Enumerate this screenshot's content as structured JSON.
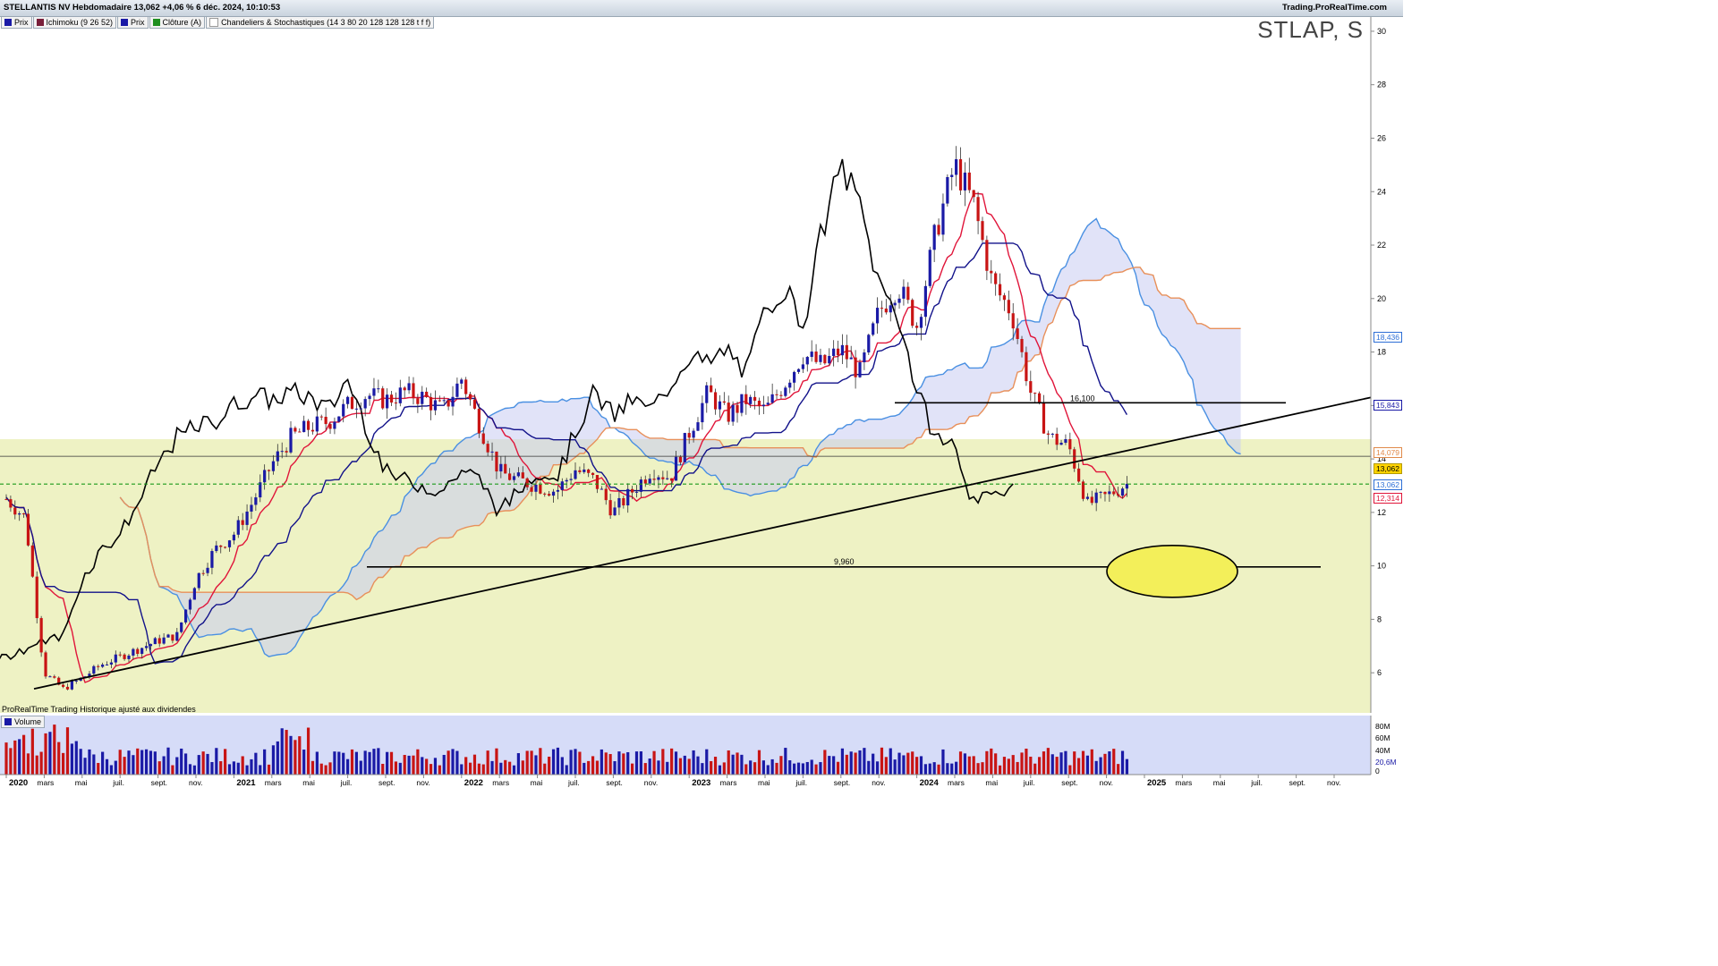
{
  "header": {
    "title": "STELLANTIS NV Hebdomadaire 13,062 +4,06 % 6 déc. 2024, 10:10:53",
    "brand": "Trading.ProRealTime.com"
  },
  "legend": [
    {
      "label": "Prix",
      "color": "#1a1aa6"
    },
    {
      "label": "Ichimoku (9 26 52)",
      "color": "#7a1f3a"
    },
    {
      "label": "Prix",
      "color": "#1a1aa6"
    },
    {
      "label": "Clôture (A)",
      "color": "#1f8f1f"
    },
    {
      "label": "Chandeliers & Stochastiques (14 3 80 20 128 128 128 t f f)",
      "color": "#ffffff"
    }
  ],
  "symbol": "STLAP, S",
  "footer_note": "ProRealTime Trading  Historique ajusté aux dividendes",
  "volume_label": "Volume",
  "annotations": {
    "level_high": "16,100",
    "level_low": "9,960"
  },
  "badges": [
    {
      "text": "18,436",
      "color": "#2e6fd6"
    },
    {
      "text": "15,843",
      "color": "#1a1aa6"
    },
    {
      "text": "14,079",
      "color": "#e08a4a"
    },
    {
      "text": "13,062",
      "color": "#000000",
      "bg": "#ffd400"
    },
    {
      "text": "13,062",
      "color": "#2e6fd6"
    },
    {
      "text": "12,314",
      "color": "#e0153a"
    }
  ],
  "colors": {
    "up_candle": "#1a1aa6",
    "down_candle": "#c81414",
    "tenkan": "#e0153a",
    "kijun": "#12128a",
    "senkou_a": "#4a90e2",
    "senkou_b": "#e8905a",
    "chikou": "#000000",
    "cloud": "#c9ccf2",
    "band": "#eef2c4",
    "highlight_ellipse": "#f3ef5a"
  },
  "chart_data": {
    "type": "candlestick",
    "timeframe": "weekly",
    "ylim": [
      4.5,
      30.5
    ],
    "y_ticks": [
      6,
      8,
      10,
      12,
      14,
      16,
      18,
      20,
      22,
      24,
      26,
      28,
      30
    ],
    "x_tick_labels": [
      "2020",
      "mars",
      "mai",
      "juil.",
      "sept.",
      "nov.",
      "2021",
      "mars",
      "mai",
      "juil.",
      "sept.",
      "nov.",
      "2022",
      "mars",
      "mai",
      "juil.",
      "sept.",
      "nov.",
      "2023",
      "mars",
      "mai",
      "juil.",
      "sept.",
      "nov.",
      "2024",
      "mars",
      "mai",
      "juil.",
      "sept.",
      "nov.",
      "2025",
      "mars",
      "mai",
      "juil.",
      "sept.",
      "nov."
    ],
    "close_path": [
      [
        "2020-01",
        12.5
      ],
      [
        "2020-02",
        11.8
      ],
      [
        "2020-03",
        6.0
      ],
      [
        "2020-04",
        5.4
      ],
      [
        "2020-05",
        5.8
      ],
      [
        "2020-06",
        6.3
      ],
      [
        "2020-07",
        6.6
      ],
      [
        "2020-08",
        6.9
      ],
      [
        "2020-09",
        7.2
      ],
      [
        "2020-10",
        7.4
      ],
      [
        "2020-11",
        9.5
      ],
      [
        "2020-12",
        10.6
      ],
      [
        "2021-01",
        11.2
      ],
      [
        "2021-02",
        12.4
      ],
      [
        "2021-03",
        13.8
      ],
      [
        "2021-04",
        14.8
      ],
      [
        "2021-05",
        15.2
      ],
      [
        "2021-06",
        15.4
      ],
      [
        "2021-07",
        16.0
      ],
      [
        "2021-08",
        16.4
      ],
      [
        "2021-09",
        16.2
      ],
      [
        "2021-10",
        16.5
      ],
      [
        "2021-11",
        16.3
      ],
      [
        "2021-12",
        15.8
      ],
      [
        "2022-01",
        17.0
      ],
      [
        "2022-02",
        15.2
      ],
      [
        "2022-03",
        13.5
      ],
      [
        "2022-04",
        13.2
      ],
      [
        "2022-05",
        13.0
      ],
      [
        "2022-06",
        12.8
      ],
      [
        "2022-07",
        13.6
      ],
      [
        "2022-08",
        13.2
      ],
      [
        "2022-09",
        12.0
      ],
      [
        "2022-10",
        12.8
      ],
      [
        "2022-11",
        13.6
      ],
      [
        "2022-12",
        13.3
      ],
      [
        "2023-01",
        15.0
      ],
      [
        "2023-02",
        16.5
      ],
      [
        "2023-03",
        15.6
      ],
      [
        "2023-04",
        16.2
      ],
      [
        "2023-05",
        15.8
      ],
      [
        "2023-06",
        16.8
      ],
      [
        "2023-07",
        17.9
      ],
      [
        "2023-08",
        17.5
      ],
      [
        "2023-09",
        18.1
      ],
      [
        "2023-10",
        17.2
      ],
      [
        "2023-11",
        19.5
      ],
      [
        "2023-12",
        20.5
      ],
      [
        "2024-01",
        19.0
      ],
      [
        "2024-02",
        22.5
      ],
      [
        "2024-03",
        25.0
      ],
      [
        "2024-04",
        23.5
      ],
      [
        "2024-05",
        20.5
      ],
      [
        "2024-06",
        19.5
      ],
      [
        "2024-07",
        16.5
      ],
      [
        "2024-08",
        14.8
      ],
      [
        "2024-09",
        14.5
      ],
      [
        "2024-10",
        12.3
      ],
      [
        "2024-11",
        12.6
      ],
      [
        "2024-12",
        13.06
      ]
    ],
    "horizontal_levels": [
      {
        "label": "16,100",
        "value": 16.1
      },
      {
        "label": "9,960",
        "value": 9.96
      },
      {
        "label": "",
        "value": 14.1
      },
      {
        "label": "",
        "value": 13.06
      }
    ],
    "volume": {
      "y_ticks": [
        "80M",
        "60M",
        "40M",
        "20,6M",
        "0"
      ],
      "last": "20,6M",
      "ylim": [
        0,
        90
      ]
    }
  }
}
